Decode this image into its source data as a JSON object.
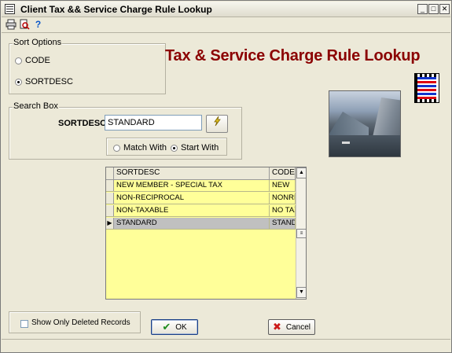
{
  "window": {
    "title": "Client Tax && Service Charge Rule Lookup",
    "controls": {
      "minimize": "_",
      "maximize": "□",
      "close": "✕"
    }
  },
  "toolbar": {
    "print_icon": "printer-icon",
    "preview_icon": "print-preview-icon",
    "help_icon": "help-icon",
    "help_glyph": "?"
  },
  "heading": "Tax & Service Charge Rule Lookup",
  "sort_options": {
    "label": "Sort Options",
    "options": [
      {
        "label": "CODE",
        "selected": false
      },
      {
        "label": "SORTDESC",
        "selected": true
      }
    ]
  },
  "search_box": {
    "label": "Search Box",
    "field_label": "SORTDESC",
    "value": "STANDARD",
    "match_options": [
      {
        "label": "Match With",
        "selected": false
      },
      {
        "label": "Start With",
        "selected": true
      }
    ]
  },
  "grid": {
    "columns": [
      "SORTDESC",
      "CODE"
    ],
    "rows": [
      {
        "sortdesc": "NEW MEMBER - SPECIAL TAX",
        "code": "NEW",
        "selected": false
      },
      {
        "sortdesc": "NON-RECIPROCAL",
        "code": "NONREC",
        "selected": false
      },
      {
        "sortdesc": "NON-TAXABLE",
        "code": "NO TAX",
        "selected": false
      },
      {
        "sortdesc": "STANDARD",
        "code": "STANDA",
        "selected": true
      }
    ],
    "row_indicator": "▶"
  },
  "deleted_filter": {
    "label": "Show Only Deleted Records",
    "checked": false
  },
  "buttons": {
    "ok": "OK",
    "cancel": "Cancel"
  },
  "colors": {
    "heading": "#8b0000",
    "grid_bg": "#ffff99",
    "selected_row": "#c0c0c0"
  }
}
